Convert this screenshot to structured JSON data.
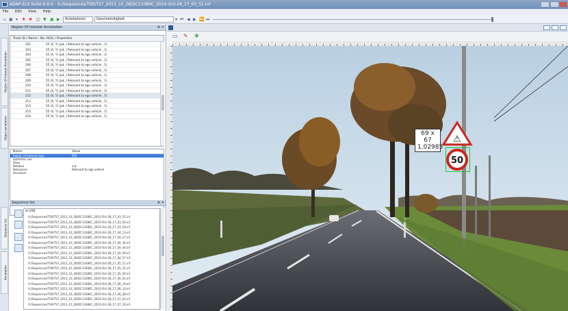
{
  "window": {
    "title": "ADAP-ELS Suite 0.9.0 - X:/Sequences/TSR/TS7_2013_10_28/DC13380C_2010-Oct-28_17_03_51.inf"
  },
  "menu": [
    "File",
    "Edit",
    "View",
    "Help"
  ],
  "toolbar": {
    "category_value": "Autobahnen",
    "filter_value": "Geschwindigkeit"
  },
  "roi_panel": {
    "title": "Region Of Interest Annotation",
    "columns": "Track ID / Name : No. ROIs / Properties",
    "rows": [
      {
        "id": "202",
        "props": "55 (X, Y) (pd, ) Relevant to ego vehicle , 1)"
      },
      {
        "id": "203",
        "props": "55 (X, Y) (pd, ) Relevant to ego vehicle , 1)"
      },
      {
        "id": "204",
        "props": "55 (X, Y) (pd, ) Relevant to ego vehicle , 1)"
      },
      {
        "id": "205",
        "props": "55 (X, Y) (pd, ) Relevant to ego vehicle , 1)"
      },
      {
        "id": "206",
        "props": "55 (X, Y) (pd, ) Relevant to ego vehicle , 1)"
      },
      {
        "id": "207",
        "props": "55 (X, Y) (pd, ) Relevant to ego vehicle , 1)"
      },
      {
        "id": "208",
        "props": "55 (X, Y) (pd, ) Relevant to ego vehicle , 1)"
      },
      {
        "id": "209",
        "props": "55 (X, Y) (pd, ) Relevant to ego vehicle , 1)"
      },
      {
        "id": "210",
        "props": "55 (X, Y) (pd, ) Relevant to ego vehicle , 1)"
      },
      {
        "id": "211",
        "props": "55 (X, Y) (pd, ) Relevant to ego vehicle , 1)"
      },
      {
        "id": "212",
        "props": "55 (X, Y) (pd, ) Relevant to ego vehicle , 1)"
      },
      {
        "id": "213",
        "props": "55 (X, Y) (pd, ) Relevant to ego vehicle , 1)"
      },
      {
        "id": "214",
        "props": "55 (X, Y) (pd, ) Relevant to ego vehicle , 1)"
      },
      {
        "id": "215",
        "props": "55 (X, Y) (pd, ) Relevant to ego vehicle , 1)"
      },
      {
        "id": "216",
        "props": "55 (X, Y) (pd, ) Relevant to ego vehicle , 1)"
      }
    ]
  },
  "properties": {
    "name_header": "Name",
    "value_header": "Value",
    "rows": [
      {
        "name": "Region of Interest type",
        "value": "ROI"
      },
      {
        "name": "Authentic use",
        "value": ""
      },
      {
        "name": "Sizes",
        "value": ""
      },
      {
        "name": "Relative",
        "value": "cut"
      },
      {
        "name": "Relevance",
        "value": "Relevant to ego vehicle"
      },
      {
        "name": "Occlusion",
        "value": ""
      }
    ]
  },
  "sequence_panel": {
    "title": "Sequence list",
    "root": "USB",
    "items": [
      "X:/Sequences/TSR/TS7_2013_10_28/DC13380C_2010-Oct-28_17_03_51.inf",
      "X:/Sequences/TSR/TS7_2013_10_28/DC13380C_2010-Oct-28_17_03_56.inf",
      "X:/Sequences/TSR/TS7_2013_10_28/DC13380C_2010-Oct-28_17_03_59.inf",
      "X:/Sequences/TSR/TS7_2013_10_28/DC13380C_2010-Oct-28_17_04_13.inf",
      "X:/Sequences/TSR/TS7_2013_10_28/DC13380C_2010-Oct-28_17_04_27.inf",
      "X:/Sequences/TSR/TS7_2013_10_28/DC13380C_2010-Oct-28_17_04_36.inf",
      "X:/Sequences/TSR/TS7_2013_10_28/DC13380C_2010-Oct-28_17_04_44.inf",
      "X:/Sequences/TSR/TS7_2013_10_28/DC13380C_2010-Oct-28_17_04_49.inf",
      "X:/Sequences/TSR/TS7_2013_10_28/DC13380C_2010-Oct-28_17_04_57.inf",
      "X:/Sequences/TSR/TS7_2013_10_28/DC13380C_2010-Oct-28_17_05_11.inf",
      "X:/Sequences/TSR/TS7_2013_10_28/DC13380C_2010-Oct-28_17_05_25.inf",
      "X:/Sequences/TSR/TS7_2013_10_28/DC13380C_2010-Oct-28_17_05_40.inf",
      "X:/Sequences/TSR/TS7_2013_10_28/DC13380C_2010-Oct-28_17_06_02.inf",
      "X:/Sequences/TSR/TS7_2013_10_28/DC13380C_2010-Oct-28_17_06_19.inf",
      "X:/Sequences/TSR/TS7_2013_10_28/DC13380C_2010-Oct-28_17_06_33.inf",
      "X:/Sequences/TSR/TS7_2013_10_28/DC13380C_2010-Oct-28_17_06_48.inf",
      "X:/Sequences/TSR/TS7_2013_10_28/DC13380C_2010-Oct-28_17_07_02.inf",
      "X:/Sequences/TSR/TS7_2013_10_28/DC13380C_2010-Oct-28_17_07_16.inf"
    ]
  },
  "left_tabs": [
    "Region Of Interest Annotation",
    "Object annotation",
    "Sequence list",
    "Annotation"
  ],
  "annotation": {
    "size_text": "69 x 67",
    "ratio_text": "1,02985",
    "speed_limit": "50"
  },
  "colors": {
    "bbox": "#21c33a",
    "sign_red": "#c8281e",
    "window_accent": "#6f8fb8"
  }
}
